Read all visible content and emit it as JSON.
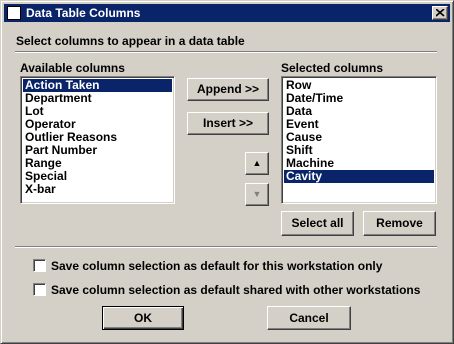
{
  "window": {
    "title": "Data Table Columns",
    "close_glyph": "✕"
  },
  "instruction": "Select columns to appear in a data table",
  "available": {
    "label": "Available columns",
    "items": [
      {
        "label": "Action Taken",
        "selected": true
      },
      {
        "label": "Department",
        "selected": false
      },
      {
        "label": "Lot",
        "selected": false
      },
      {
        "label": "Operator",
        "selected": false
      },
      {
        "label": "Outlier Reasons",
        "selected": false
      },
      {
        "label": "Part Number",
        "selected": false
      },
      {
        "label": "Range",
        "selected": false
      },
      {
        "label": "Special",
        "selected": false
      },
      {
        "label": "X-bar",
        "selected": false
      }
    ]
  },
  "selected": {
    "label": "Selected columns",
    "items": [
      {
        "label": "Row",
        "selected": false
      },
      {
        "label": "Date/Time",
        "selected": false
      },
      {
        "label": "Data",
        "selected": false
      },
      {
        "label": "Event",
        "selected": false
      },
      {
        "label": "Cause",
        "selected": false
      },
      {
        "label": "Shift",
        "selected": false
      },
      {
        "label": "Machine",
        "selected": false
      },
      {
        "label": "Cavity",
        "selected": true
      }
    ]
  },
  "buttons": {
    "append": "Append >>",
    "insert": "Insert >>",
    "move_up": "▲",
    "move_down": "▼",
    "select_all": "Select all",
    "remove": "Remove",
    "ok": "OK",
    "cancel": "Cancel"
  },
  "options": {
    "workstation_only": "Save column selection as default for this workstation only",
    "shared": "Save column selection as default shared with other workstations",
    "workstation_only_checked": false,
    "shared_checked": false
  },
  "colors": {
    "face": "#d4d0c8",
    "titlebar": "#0a246a",
    "selection": "#0a246a"
  }
}
